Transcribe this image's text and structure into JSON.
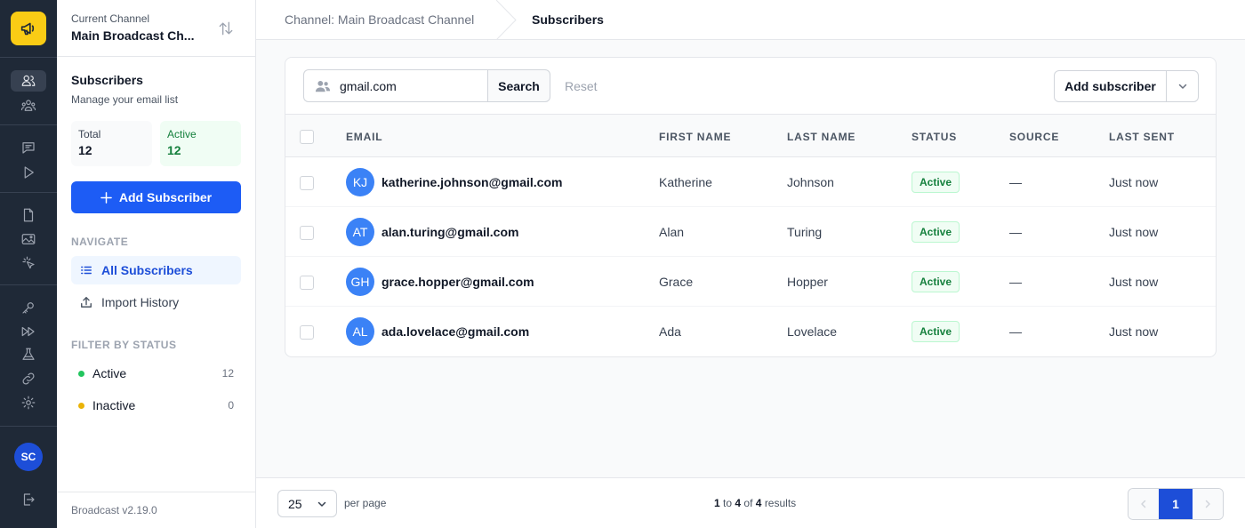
{
  "channel": {
    "label": "Current Channel",
    "name": "Main Broadcast Ch..."
  },
  "sidebar": {
    "title": "Subscribers",
    "subtitle": "Manage your email list",
    "stats": {
      "total_label": "Total",
      "total_value": "12",
      "active_label": "Active",
      "active_value": "12"
    },
    "add_button": "Add Subscriber",
    "navigate_label": "NAVIGATE",
    "nav": [
      {
        "label": "All Subscribers",
        "icon": "list-icon"
      },
      {
        "label": "Import History",
        "icon": "upload-icon"
      }
    ],
    "filter_label": "FILTER BY STATUS",
    "filters": [
      {
        "label": "Active",
        "count": "12",
        "color": "#22c55e"
      },
      {
        "label": "Inactive",
        "count": "0",
        "color": "#eab308"
      }
    ],
    "version": "Broadcast v2.19.0"
  },
  "user": {
    "initials": "SC"
  },
  "breadcrumb": {
    "parent": "Channel: Main Broadcast Channel",
    "current": "Subscribers"
  },
  "toolbar": {
    "search_value": "gmail.com",
    "search_button": "Search",
    "reset_button": "Reset",
    "add_button": "Add subscriber"
  },
  "table": {
    "columns": [
      "EMAIL",
      "FIRST NAME",
      "LAST NAME",
      "STATUS",
      "SOURCE",
      "LAST SENT"
    ],
    "rows": [
      {
        "initials": "KJ",
        "email": "katherine.johnson@gmail.com",
        "first": "Katherine",
        "last": "Johnson",
        "status": "Active",
        "source": "—",
        "last_sent": "Just now"
      },
      {
        "initials": "AT",
        "email": "alan.turing@gmail.com",
        "first": "Alan",
        "last": "Turing",
        "status": "Active",
        "source": "—",
        "last_sent": "Just now"
      },
      {
        "initials": "GH",
        "email": "grace.hopper@gmail.com",
        "first": "Grace",
        "last": "Hopper",
        "status": "Active",
        "source": "—",
        "last_sent": "Just now"
      },
      {
        "initials": "AL",
        "email": "ada.lovelace@gmail.com",
        "first": "Ada",
        "last": "Lovelace",
        "status": "Active",
        "source": "—",
        "last_sent": "Just now"
      }
    ]
  },
  "pagination": {
    "per_page": "25",
    "per_page_label": "per page",
    "from": "1",
    "to_word": "to",
    "to": "4",
    "of_word": "of",
    "total": "4",
    "results_word": "results",
    "current_page": "1"
  },
  "colors": {
    "accent": "#1d5cf5",
    "rail_bg": "#1f2937",
    "logo": "#facc15",
    "active_status": "#15803d"
  }
}
